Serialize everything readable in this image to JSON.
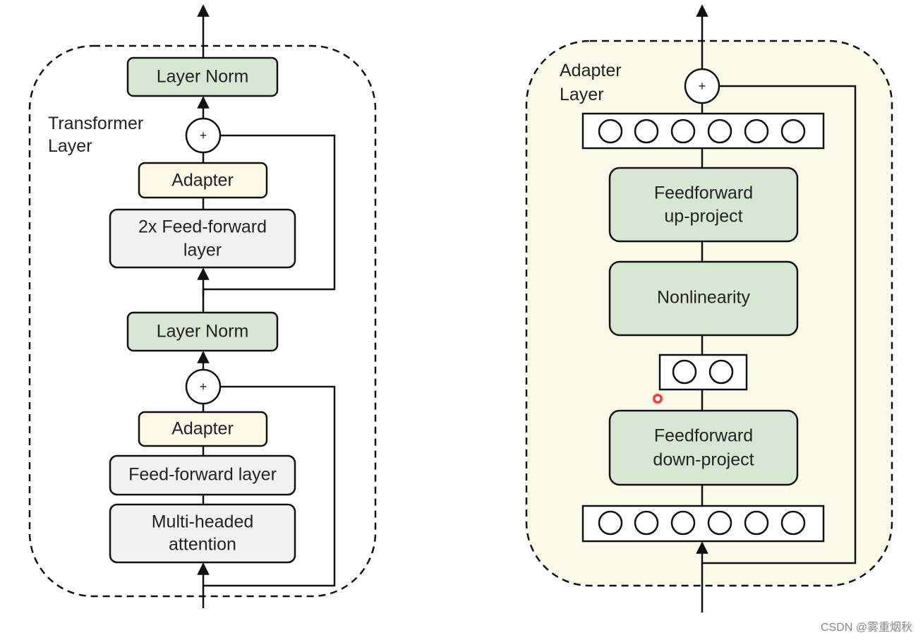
{
  "colors": {
    "norm": "#d8e7d4",
    "adapter": "#fcfae6",
    "ff": "#f1f1f1",
    "adapter_bg": "#fbfbea",
    "stroke": "#111111",
    "cursor": "#e53935"
  },
  "left": {
    "title_line1": "Transformer",
    "title_line2": "Layer",
    "layer_norm_top": "Layer Norm",
    "plus_top": "+",
    "adapter_top": "Adapter",
    "ff2x_line1": "2x Feed-forward",
    "ff2x_line2": "layer",
    "layer_norm_bottom": "Layer Norm",
    "plus_bottom": "+",
    "adapter_bottom": "Adapter",
    "ff": "Feed-forward layer",
    "mha_line1": "Multi-headed",
    "mha_line2": "attention"
  },
  "right": {
    "title_line1": "Adapter",
    "title_line2": "Layer",
    "plus": "+",
    "up_line1": "Feedforward",
    "up_line2": "up-project",
    "nonlinearity": "Nonlinearity",
    "down_line1": "Feedforward",
    "down_line2": "down-project"
  },
  "watermark": "CSDN @雾重烟秋"
}
